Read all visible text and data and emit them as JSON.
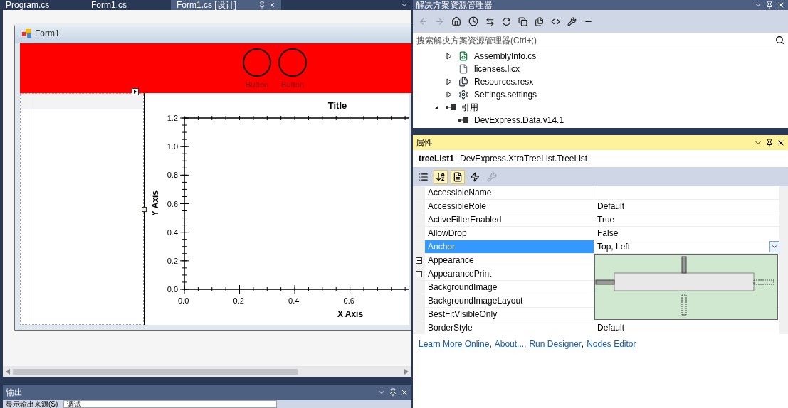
{
  "editor_tabs": [
    {
      "label": "Program.cs",
      "selected": false
    },
    {
      "label": "Form1.cs",
      "selected": false
    },
    {
      "label": "Form1.cs [设计]",
      "selected": true
    }
  ],
  "designer": {
    "form_title": "Form1",
    "header_buttons": [
      "Button",
      "Button"
    ],
    "chart_data": {
      "type": "line",
      "title": "Title",
      "xlabel": "X Axis",
      "ylabel": "Y Axis",
      "xlim": [
        0,
        0.81
      ],
      "ylim": [
        0,
        1.2
      ],
      "xticks": [
        {
          "value": 0,
          "label": "0.0"
        },
        0.2,
        0.4,
        0.6
      ],
      "yticks": [
        {
          "value": 0,
          "label": "0.0"
        },
        0.2,
        0.4,
        0.6,
        0.8,
        {
          "value": 1,
          "label": "1.0"
        },
        1.2
      ]
    }
  },
  "solution_explorer": {
    "title": "解决方案资源管理器",
    "search": {
      "placeholder": "搜索解决方案资源管理器(Ctrl+;)"
    },
    "scrolled_branch": [
      {
        "label": "AssemblyInfo.cs",
        "kind": "csharp",
        "expanded": false
      },
      {
        "label": "licenses.licx",
        "kind": "file"
      },
      {
        "label": "Resources.resx",
        "kind": "resources",
        "expanded": false
      },
      {
        "label": "Settings.settings",
        "kind": "settings",
        "expanded": false
      }
    ],
    "tree": [
      {
        "label": "引用",
        "kind": "reference",
        "expanded": true,
        "children": [
          {
            "label": "DevExpress.Data.v14.1",
            "kind": "reference"
          }
        ]
      }
    ]
  },
  "properties": {
    "title": "属性",
    "object_name": "treeList1",
    "object_type": "DevExpress.XtraTreeList.TreeList",
    "toolbar": [
      {
        "kind": "categorized",
        "selected": false
      },
      {
        "kind": "alphabetical",
        "selected": true
      },
      {
        "kind": "properties",
        "selected": true
      },
      {
        "kind": "events",
        "selected": false
      },
      {
        "kind": "property_pages",
        "selected": false
      }
    ],
    "rows": [
      {
        "name": "AccessibleName",
        "value": "",
        "expandable": false,
        "selected": false
      },
      {
        "name": "AccessibleRole",
        "value": "Default",
        "expandable": false,
        "selected": false
      },
      {
        "name": "ActiveFilterEnabled",
        "value": "True",
        "expandable": false,
        "selected": false
      },
      {
        "name": "AllowDrop",
        "value": "False",
        "expandable": false,
        "selected": false
      },
      {
        "name": "Anchor",
        "value": "Top, Left",
        "expandable": false,
        "selected": true,
        "kind": "dropdown"
      },
      {
        "name": "Appearance",
        "value": "",
        "expandable": true,
        "selected": false
      },
      {
        "name": "AppearancePrint",
        "value": "",
        "expandable": true,
        "selected": false
      },
      {
        "name": "BackgroundImage",
        "value": "",
        "expandable": false,
        "selected": false
      },
      {
        "name": "BackgroundImageLayout",
        "value": "",
        "expandable": false,
        "selected": false
      },
      {
        "name": "BestFitVisibleOnly",
        "value": "",
        "expandable": false,
        "selected": false
      },
      {
        "name": "BorderStyle",
        "value": "Default",
        "expandable": false,
        "selected": false
      }
    ],
    "anchor_editor": {
      "open": true,
      "top": true,
      "left": true,
      "right": false,
      "bottom": false
    },
    "links": [
      {
        "text": "Learn More Online",
        "after": ","
      },
      {
        "text": "About...",
        "after": ","
      },
      {
        "text": "Run Designer",
        "after": ","
      },
      {
        "text": "Nodes Editor"
      }
    ]
  },
  "output": {
    "title": "输出",
    "source_label": "显示输出来源(S)",
    "source_value": "调试"
  }
}
